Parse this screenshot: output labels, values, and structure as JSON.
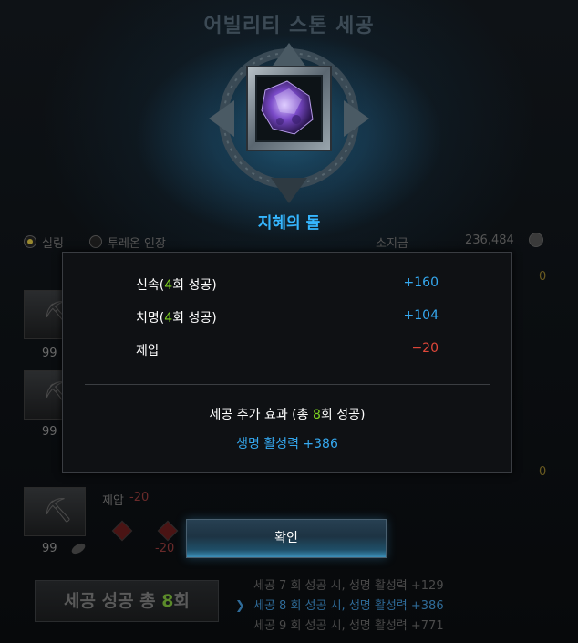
{
  "window": {
    "title": "어빌리티 스톤 세공"
  },
  "stone": {
    "name": "지혜의 돌"
  },
  "currency": {
    "option1": "실링",
    "option2": "투레온 인장",
    "holdings_label": "소지금",
    "holdings_value": "236,484"
  },
  "background_panel": {
    "slot_counts": [
      "99",
      "99",
      "99"
    ],
    "right_value_top": "0",
    "right_value_bottom": "0",
    "penalty_label": "제압",
    "penalty_value": "-20",
    "penalty_value_2": "-20",
    "total_prefix": "세공 성공 총 ",
    "total_count": "8",
    "total_suffix": "회",
    "bonus_list": [
      "세공 7 회 성공 시, 생명 활성력 +129",
      "세공 8 회 성공 시, 생명 활성력 +386",
      "세공 9 회 성공 시, 생명 활성력 +771"
    ]
  },
  "result_modal": {
    "stats": [
      {
        "prefix": "신속(",
        "count": "4",
        "suffix": "회 성공)",
        "value": "+160",
        "color": "#35a8ef"
      },
      {
        "prefix": "치명(",
        "count": "4",
        "suffix": "회 성공)",
        "value": "+104",
        "color": "#35a8ef"
      },
      {
        "label": "제압",
        "value": "−20",
        "color": "#e0473a"
      }
    ],
    "extra_prefix": "세공 추가 효과 (총 ",
    "extra_count": "8",
    "extra_suffix": "회 성공)",
    "extra_effect": "생명 활성력 +386",
    "confirm_label": "확인"
  },
  "colors": {
    "accent_blue": "#35b6ff",
    "success_green": "#7ed321",
    "penalty_red": "#e0473a"
  }
}
